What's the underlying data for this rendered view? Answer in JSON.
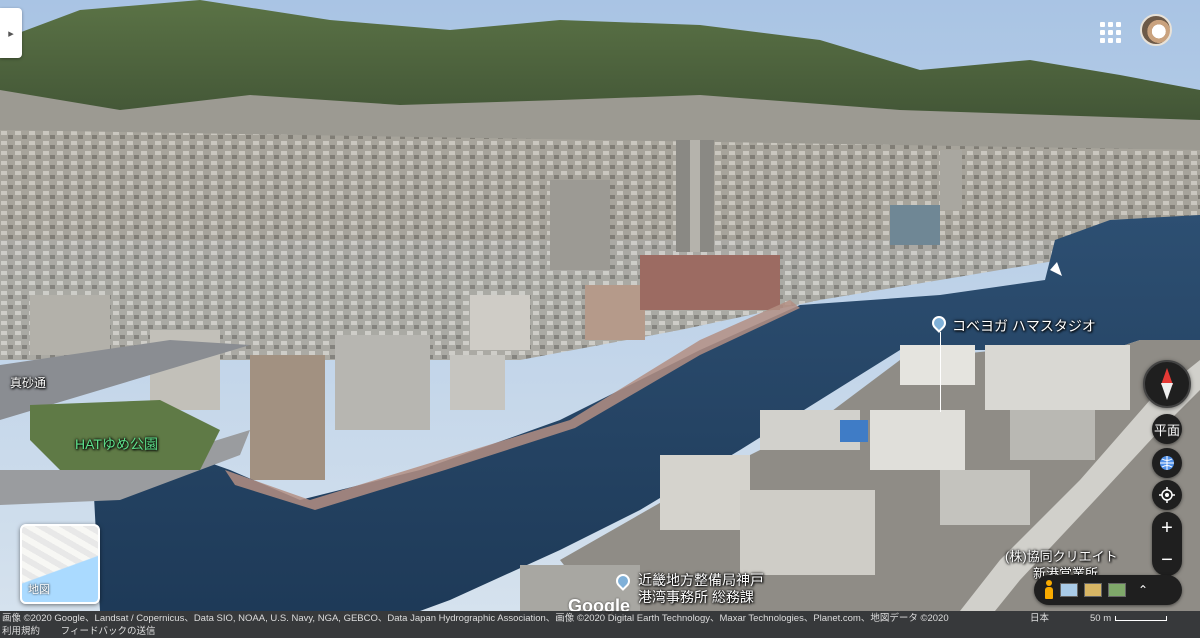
{
  "controls": {
    "collapse_icon": "▸",
    "minimap_label": "地図",
    "flat_view_label": "平面",
    "zoom_in": "+",
    "zoom_out": "−",
    "layers_chevron": "⌃"
  },
  "places": [
    {
      "id": "masago",
      "text": "真砂通"
    },
    {
      "id": "hat",
      "text": "HATゆめ公園"
    },
    {
      "id": "studio",
      "text": "コベヨガ ハマスタジオ"
    },
    {
      "id": "kyodo1",
      "text": "(株)協同クリエイト"
    },
    {
      "id": "kyodo2",
      "text": "新港営業所"
    },
    {
      "id": "kinki1",
      "text": "近畿地方整備局神戸"
    },
    {
      "id": "kinki2",
      "text": "港湾事務所 総務課"
    }
  ],
  "logo": "Google",
  "footer": {
    "attribution": "画像 ©2020 Google、Landsat / Copernicus、Data SIO, NOAA, U.S. Navy, NGA, GEBCO、Data Japan Hydrographic Association、画像 ©2020 Digital Earth Technology、Maxar Technologies、Planet.com、地図データ ©2020",
    "language": "日本",
    "scale": "50 m",
    "terms": "利用規約",
    "feedback": "フィードバックの送信"
  },
  "colors": {
    "water": "#2a4a6a",
    "sky": "#c8dcf0",
    "mountain": "#4d6a3c",
    "compass_north": "#e53935",
    "pegman": "#f9ab00"
  }
}
